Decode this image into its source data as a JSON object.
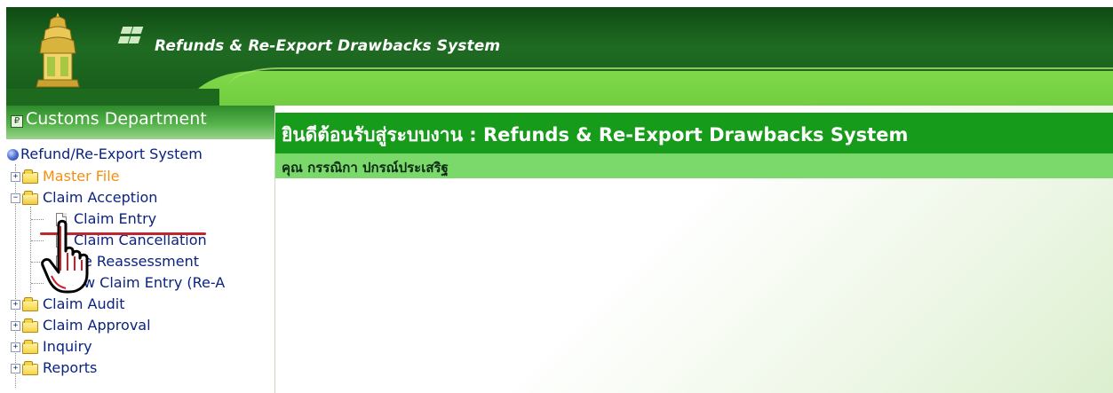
{
  "header": {
    "app_title": "Refunds & Re-Export Drawbacks System",
    "logo": "customs-emblem-icon",
    "brand_colors": {
      "dark_green": "#0f4a14",
      "light_green": "#7fd84a"
    }
  },
  "sidebar": {
    "department_title": "Customs Department",
    "pin_icon": "pin-icon",
    "tree": {
      "root_label": "Refund/Re-Export System",
      "items": [
        {
          "label": "Master File",
          "expanded": false,
          "color": "#f28f10"
        },
        {
          "label": "Claim Acception",
          "expanded": true,
          "children": [
            {
              "label": "Claim Entry",
              "selected": true
            },
            {
              "label": "Claim Cancellation"
            },
            {
              "label": "e Reassessment"
            },
            {
              "label": "w Claim Entry (Re-A"
            }
          ]
        },
        {
          "label": "Claim Audit",
          "expanded": false
        },
        {
          "label": "Claim Approval",
          "expanded": false
        },
        {
          "label": "Inquiry",
          "expanded": false
        },
        {
          "label": "Reports",
          "expanded": false
        }
      ]
    }
  },
  "main": {
    "welcome_text": "ยินดีต้อนรับสู่ระบบงาน : Refunds & Re-Export Drawbacks System",
    "user_text": "คุณ กรรณิกา ปกรณ์ประเสริฐ",
    "colors": {
      "welcome_bar": "#169b1a",
      "user_bar": "#7bd86b"
    }
  },
  "overlay": {
    "cursor": "hand-pointer-cursor-icon"
  }
}
